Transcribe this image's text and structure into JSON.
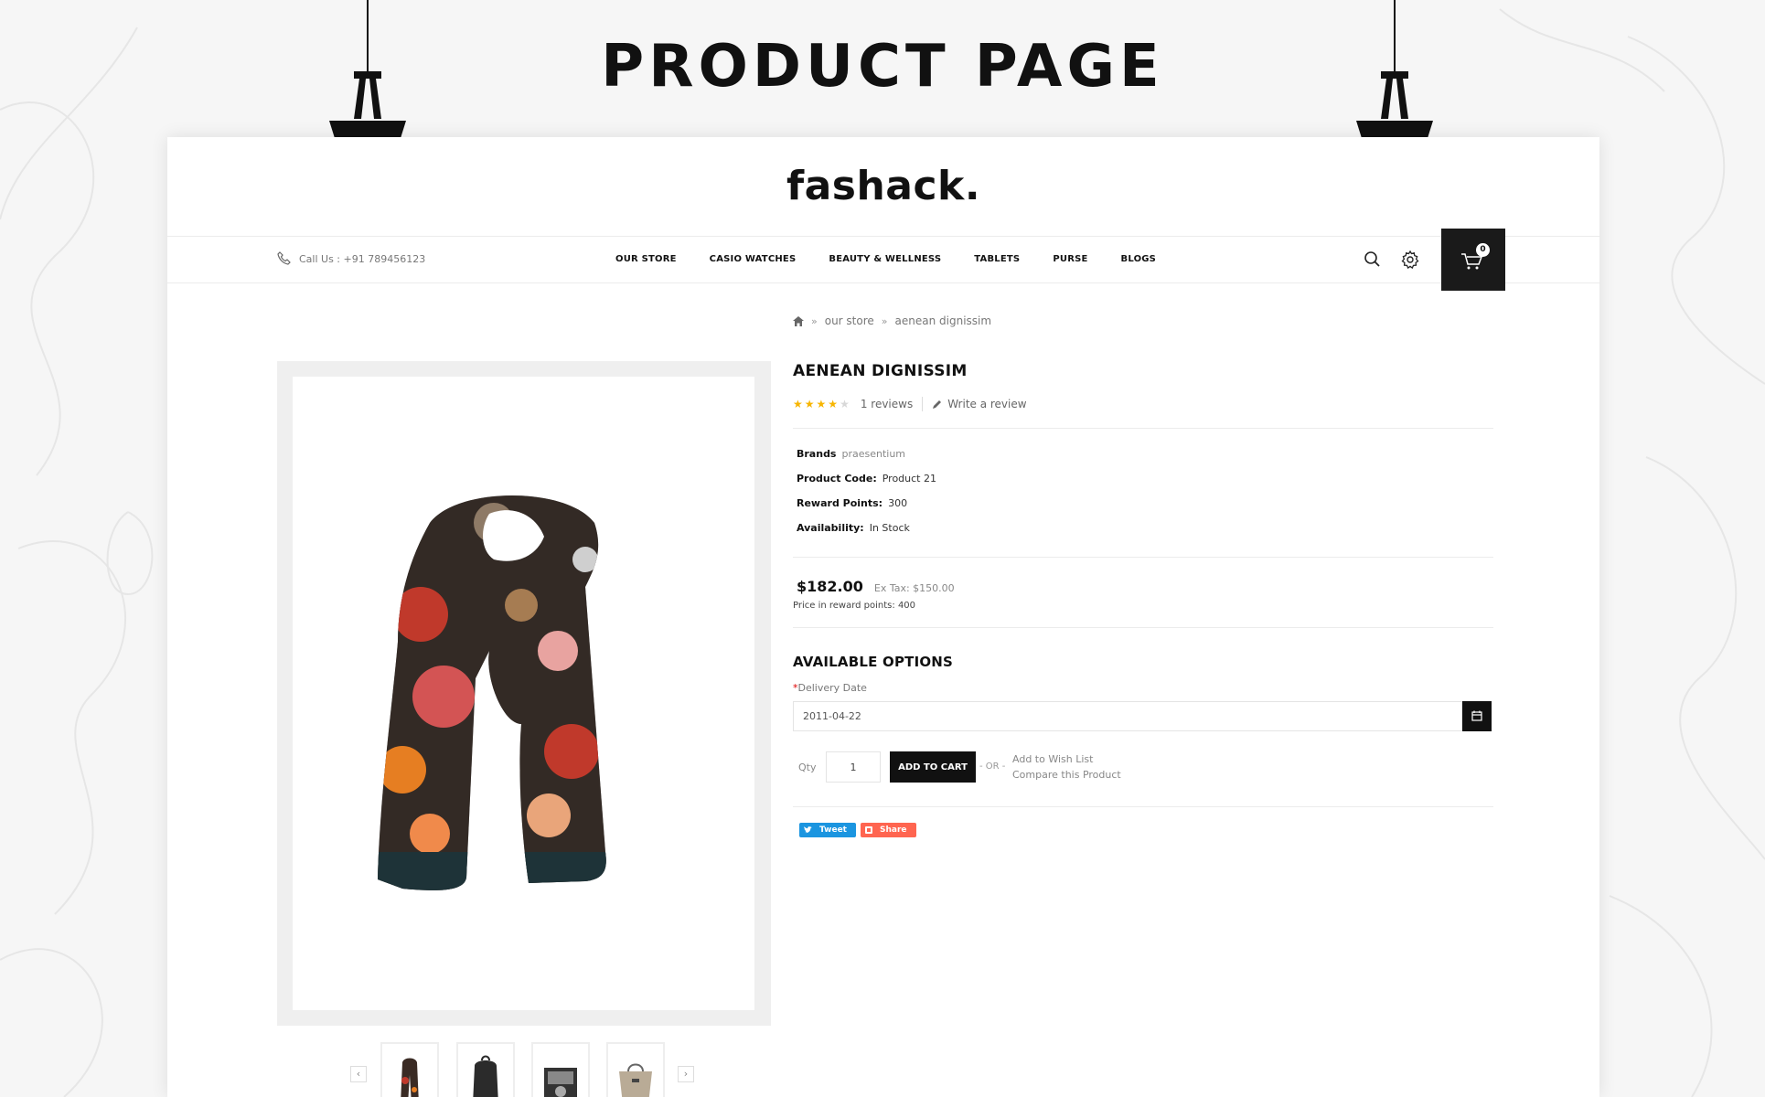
{
  "page": {
    "heading": "PRODUCT PAGE"
  },
  "store": {
    "logo": "fashack.",
    "call": "Call Us : +91 789456123",
    "menu": [
      "OUR STORE",
      "CASIO WATCHES",
      "BEAUTY & WELLNESS",
      "TABLETS",
      "PURSE",
      "BLOGS"
    ],
    "cart_count": "0"
  },
  "breadcrumb": [
    "our store",
    "aenean dignissim"
  ],
  "product": {
    "title": "AENEAN DIGNISSIM",
    "rating": 4,
    "rating_max": 5,
    "reviews": "1 reviews",
    "write_review": "Write a review",
    "brand_label": "Brands",
    "brand_value": "praesentium",
    "code_label": "Product Code:",
    "code_value": "Product 21",
    "reward_label": "Reward Points:",
    "reward_value": "300",
    "availability_label": "Availability:",
    "availability_value": "In Stock",
    "price": "$182.00",
    "ex_tax": "Ex Tax: $150.00",
    "reward_price": "Price in reward points: 400"
  },
  "options": {
    "title": "AVAILABLE OPTIONS",
    "delivery_label": "Delivery Date",
    "delivery_required": "*",
    "delivery_value": "2011-04-22"
  },
  "cart": {
    "qty_label": "Qty",
    "qty_value": "1",
    "add_to_cart": "ADD TO CART",
    "or": "- OR -",
    "wishlist": "Add to Wish List",
    "compare": "Compare this Product"
  },
  "social": {
    "tweet": "Tweet",
    "share": "Share"
  },
  "colors": {
    "accent": "#111111",
    "star": "#f7b500",
    "tweet": "#1b95e0",
    "share": "#ff6550"
  },
  "thumbnails": [
    "scarf",
    "backpack",
    "watch-box",
    "handbag"
  ]
}
